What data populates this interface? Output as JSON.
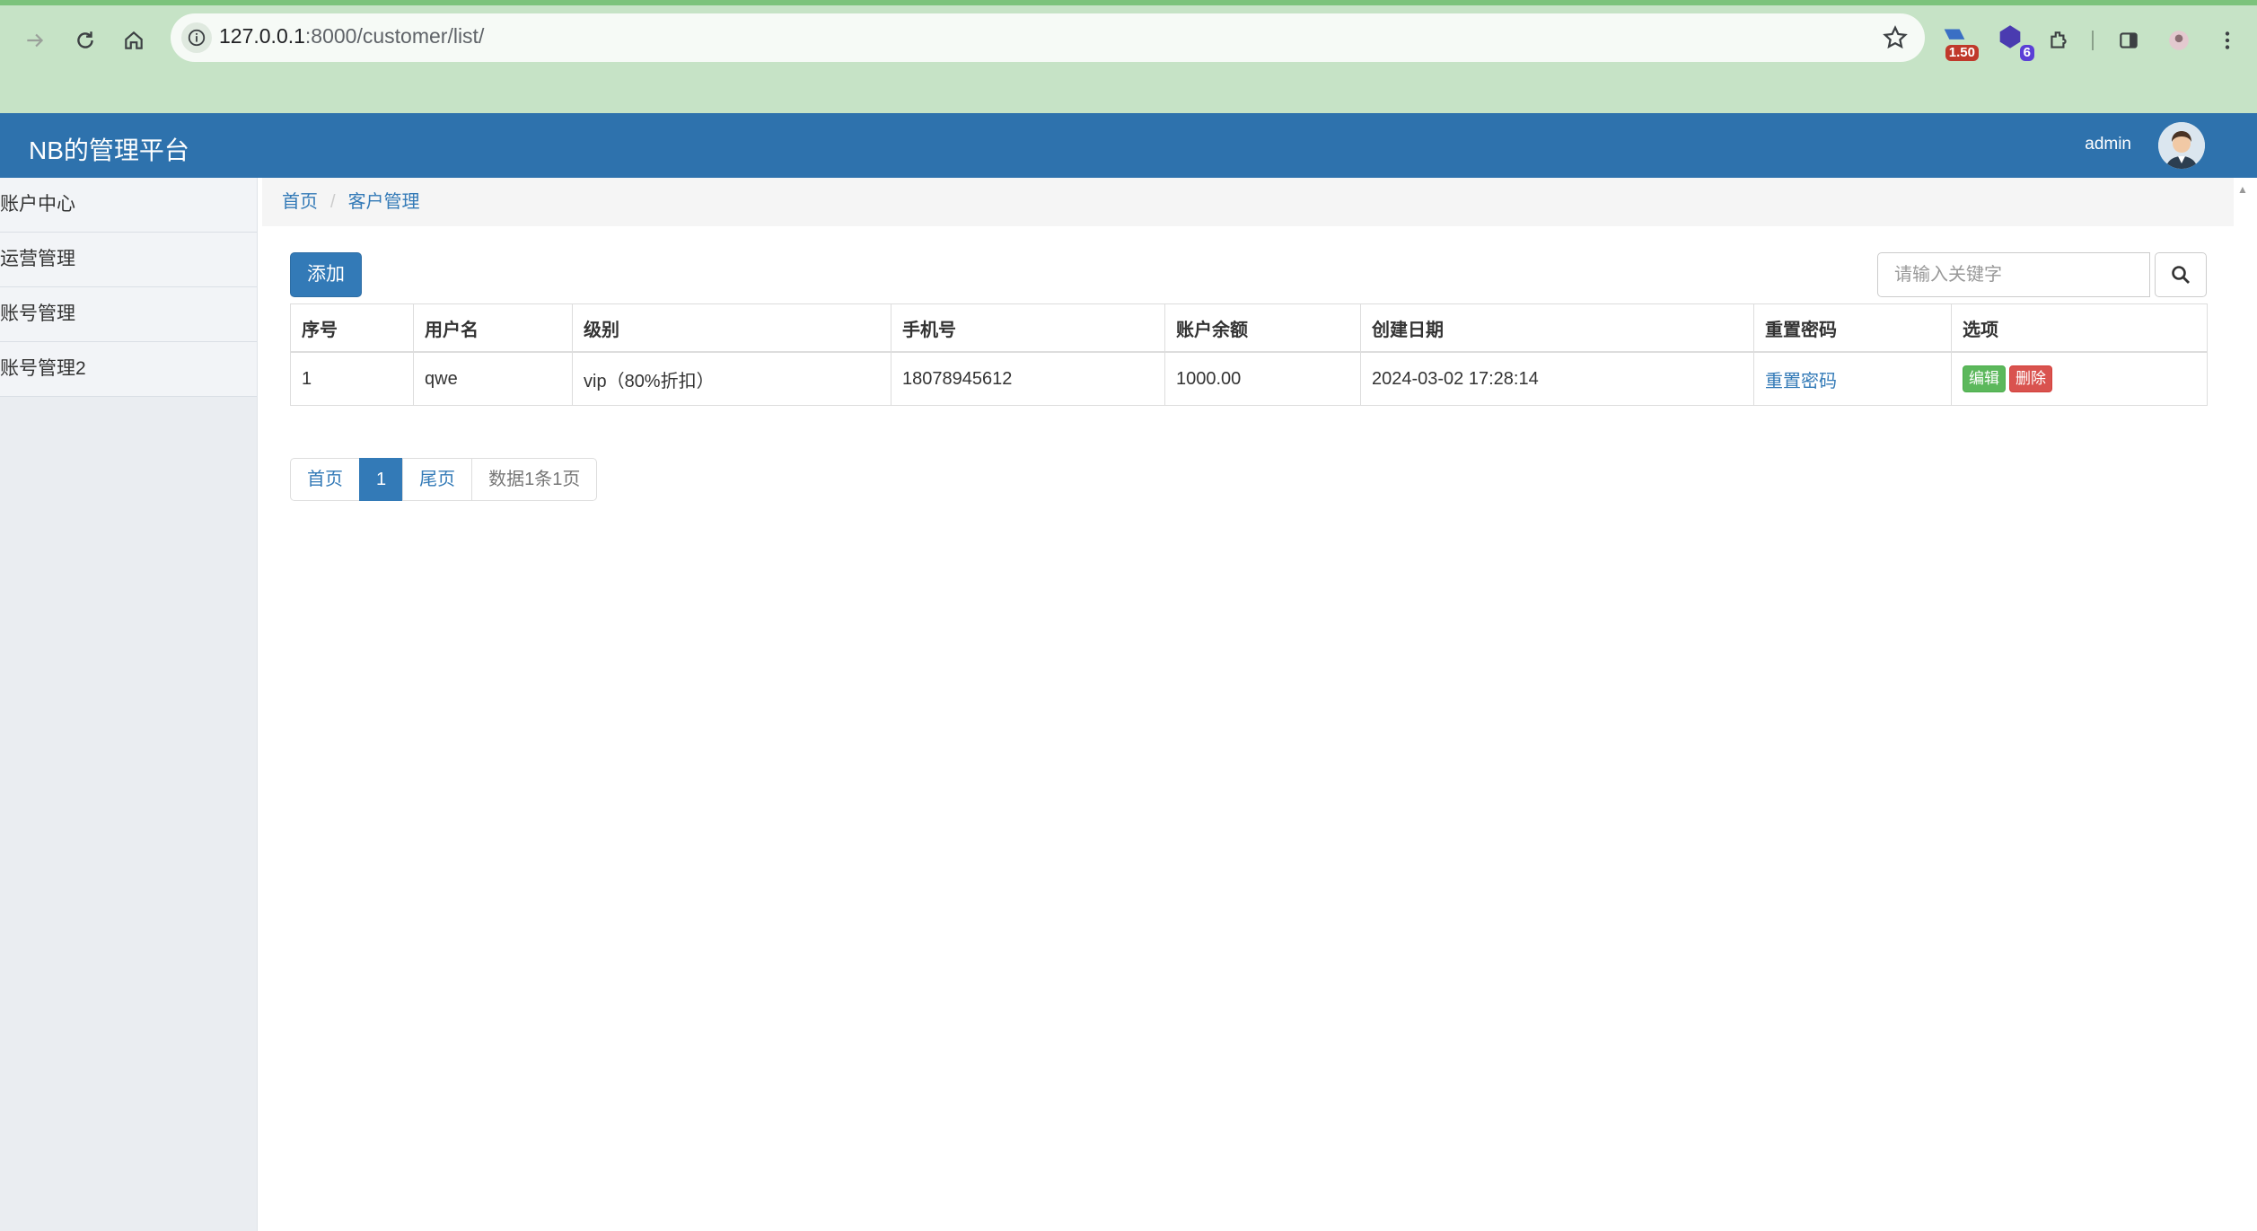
{
  "browser": {
    "url_host": "127.0.0.1",
    "url_path": ":8000/customer/list/",
    "ext1_badge": "1.50",
    "ext2_badge": "6"
  },
  "navbar": {
    "brand": "NB的管理平台",
    "user": "admin"
  },
  "sidebar": {
    "items": [
      {
        "label": "账户中心"
      },
      {
        "label": "运营管理"
      },
      {
        "label": "账号管理"
      },
      {
        "label": "账号管理2"
      }
    ]
  },
  "breadcrumb": {
    "home": "首页",
    "sep": "/",
    "current": "客户管理"
  },
  "toolbar": {
    "add_label": "添加",
    "search_placeholder": "请输入关键字"
  },
  "table": {
    "headers": [
      "序号",
      "用户名",
      "级别",
      "手机号",
      "账户余额",
      "创建日期",
      "重置密码",
      "选项"
    ],
    "rows": [
      {
        "id": "1",
        "username": "qwe",
        "level": "vip（80%折扣）",
        "phone": "18078945612",
        "balance": "1000.00",
        "created": "2024-03-02 17:28:14",
        "reset": "重置密码",
        "edit": "编辑",
        "delete": "删除"
      }
    ]
  },
  "pagination": {
    "first": "首页",
    "current": "1",
    "last": "尾页",
    "info": "数据1条1页"
  },
  "colors": {
    "navbar": "#2e72ad",
    "primary": "#337ab7",
    "success": "#5cb85c",
    "danger": "#d9534f",
    "chrome": "#c6e3c6"
  }
}
